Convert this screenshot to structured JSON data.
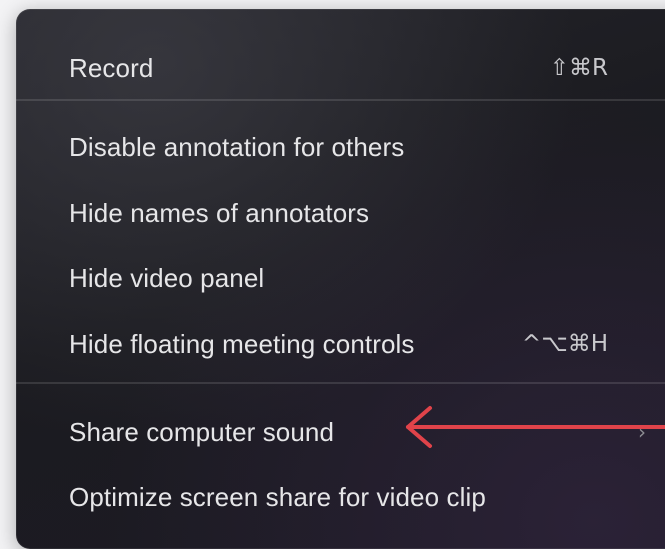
{
  "menu": {
    "items": [
      {
        "label": "Record",
        "shortcut": "⇧⌘R"
      },
      {
        "label": "Disable annotation for others",
        "shortcut": ""
      },
      {
        "label": "Hide names of annotators",
        "shortcut": ""
      },
      {
        "label": "Hide video panel",
        "shortcut": ""
      },
      {
        "label": "Hide floating meeting controls",
        "shortcut": "^⌥⌘H"
      },
      {
        "label": "Share computer sound",
        "shortcut": "",
        "submenu_indicator": "›"
      },
      {
        "label": "Optimize screen share for video clip",
        "shortcut": ""
      }
    ]
  },
  "annotation": {
    "arrow_color": "#e0434a",
    "arrow_icon": "left-arrow-icon"
  },
  "colors": {
    "menu_background": "#1d1d22",
    "text": "#e6e6e8",
    "shortcut_text": "#c8c8cc"
  }
}
